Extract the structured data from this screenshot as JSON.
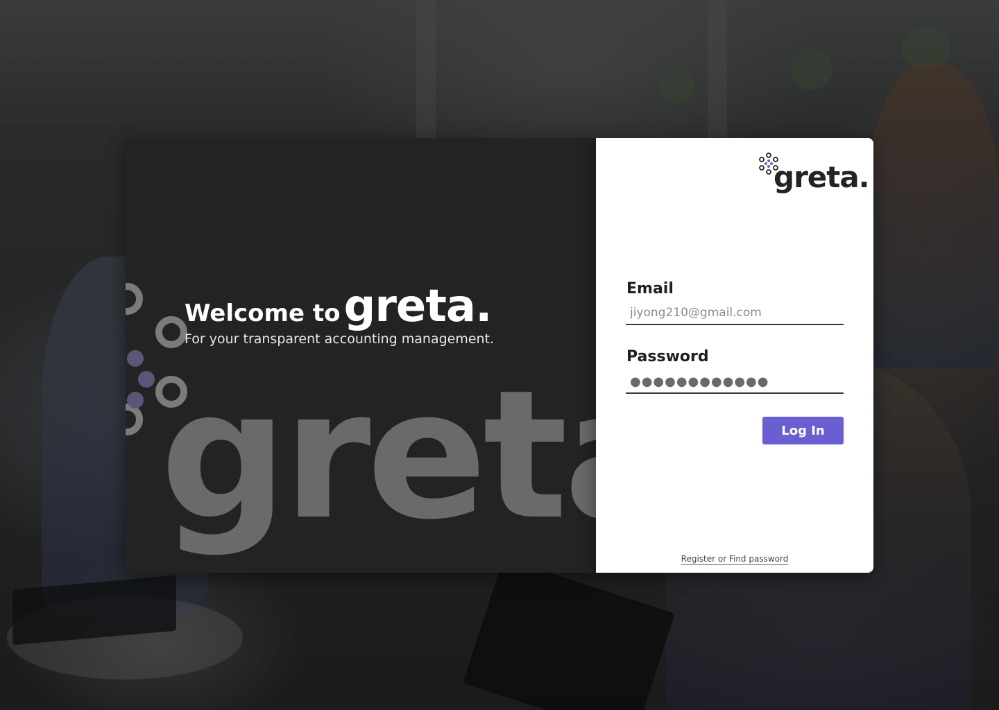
{
  "welcome": {
    "prefix": "Welcome to",
    "brand": "greta.",
    "tagline": "For your transparent accounting management.",
    "watermark": "greta"
  },
  "logo": {
    "wordmark": "greta."
  },
  "form": {
    "email_label": "Email",
    "email_value": "jiyong210@gmail.com",
    "password_label": "Password",
    "password_value": "●●●●●●●●●●●●",
    "login_label": "Log In",
    "footer_link": "Register or Find password"
  },
  "colors": {
    "accent": "#6a5fd0",
    "panel_dark": "#232323",
    "card": "#ffffff",
    "watermark": "#6a6a6a"
  },
  "icons": [
    "greta-dots-logo-icon",
    "greta-dots-decoration-icon"
  ]
}
